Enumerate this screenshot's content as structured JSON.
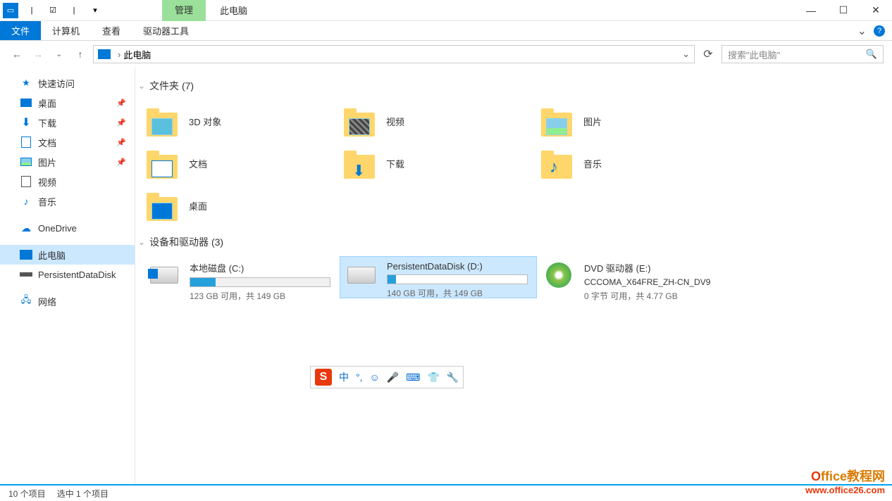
{
  "titlebar": {
    "context_tab": "管理",
    "title": "此电脑"
  },
  "ribbon": {
    "file": "文件",
    "computer": "计算机",
    "view": "查看",
    "drive_tools": "驱动器工具"
  },
  "address": {
    "location": "此电脑",
    "search_placeholder": "搜索\"此电脑\""
  },
  "sidebar": {
    "quick_access": "快速访问",
    "desktop": "桌面",
    "downloads": "下载",
    "documents": "文档",
    "pictures": "图片",
    "videos": "视频",
    "music": "音乐",
    "onedrive": "OneDrive",
    "this_pc": "此电脑",
    "persistent_disk": "PersistentDataDisk",
    "network": "网络"
  },
  "groups": {
    "folders_header": "文件夹 (7)",
    "drives_header": "设备和驱动器 (3)"
  },
  "folders": {
    "3d": "3D 对象",
    "videos": "视频",
    "pictures": "图片",
    "documents": "文档",
    "downloads": "下载",
    "music": "音乐",
    "desktop": "桌面"
  },
  "drives": {
    "c": {
      "name": "本地磁盘 (C:)",
      "text": "123 GB 可用，共 149 GB",
      "fill_pct": 18
    },
    "d": {
      "name": "PersistentDataDisk (D:)",
      "text": "140 GB 可用，共 149 GB",
      "fill_pct": 6
    },
    "e": {
      "name": "DVD 驱动器 (E:)",
      "label": "CCCOMA_X64FRE_ZH-CN_DV9",
      "text": "0 字节 可用，共 4.77 GB"
    }
  },
  "ime": {
    "logo": "S",
    "lang": "中"
  },
  "statusbar": {
    "count": "10 个项目",
    "selected": "选中 1 个项目"
  },
  "watermark": {
    "line1_prefix": "O",
    "line1_text": "ffice教程网",
    "line2": "www.office26.com"
  }
}
